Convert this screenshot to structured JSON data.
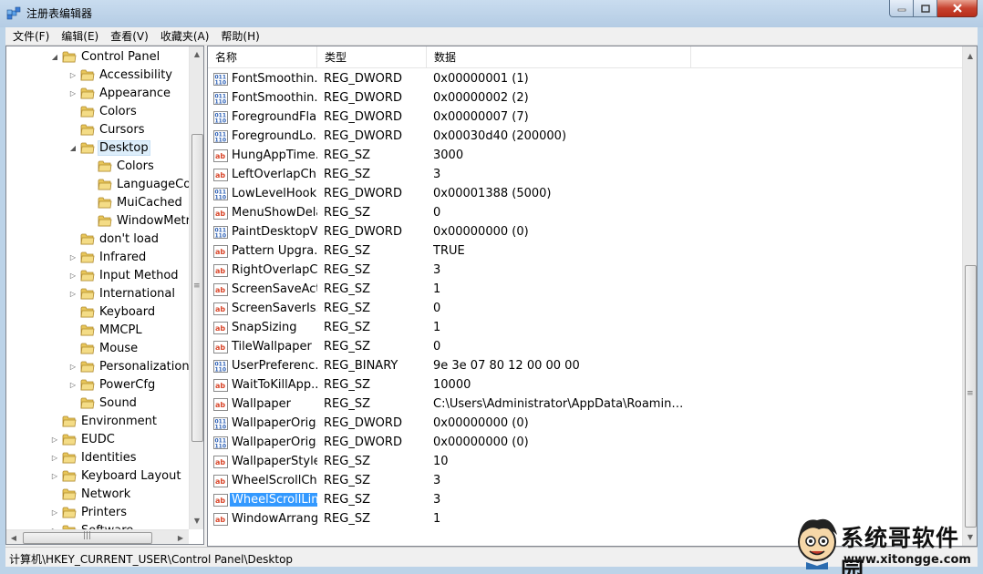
{
  "window": {
    "title": "注册表编辑器"
  },
  "menu": [
    "文件(F)",
    "编辑(E)",
    "查看(V)",
    "收藏夹(A)",
    "帮助(H)"
  ],
  "tree": [
    {
      "label": "Control Panel",
      "depth": 0,
      "expander": "open"
    },
    {
      "label": "Accessibility",
      "depth": 1,
      "expander": "closed"
    },
    {
      "label": "Appearance",
      "depth": 1,
      "expander": "closed"
    },
    {
      "label": "Colors",
      "depth": 1,
      "expander": "none"
    },
    {
      "label": "Cursors",
      "depth": 1,
      "expander": "none"
    },
    {
      "label": "Desktop",
      "depth": 1,
      "expander": "open",
      "selected": true
    },
    {
      "label": "Colors",
      "depth": 2,
      "expander": "none"
    },
    {
      "label": "LanguageConfiguration",
      "depth": 2,
      "expander": "none"
    },
    {
      "label": "MuiCached",
      "depth": 2,
      "expander": "none"
    },
    {
      "label": "WindowMetrics",
      "depth": 2,
      "expander": "none"
    },
    {
      "label": "don't load",
      "depth": 1,
      "expander": "none"
    },
    {
      "label": "Infrared",
      "depth": 1,
      "expander": "closed"
    },
    {
      "label": "Input Method",
      "depth": 1,
      "expander": "closed"
    },
    {
      "label": "International",
      "depth": 1,
      "expander": "closed"
    },
    {
      "label": "Keyboard",
      "depth": 1,
      "expander": "none"
    },
    {
      "label": "MMCPL",
      "depth": 1,
      "expander": "none"
    },
    {
      "label": "Mouse",
      "depth": 1,
      "expander": "none"
    },
    {
      "label": "Personalization",
      "depth": 1,
      "expander": "closed"
    },
    {
      "label": "PowerCfg",
      "depth": 1,
      "expander": "closed"
    },
    {
      "label": "Sound",
      "depth": 1,
      "expander": "none"
    },
    {
      "label": "Environment",
      "depth": 0,
      "expander": "none"
    },
    {
      "label": "EUDC",
      "depth": 0,
      "expander": "closed"
    },
    {
      "label": "Identities",
      "depth": 0,
      "expander": "closed"
    },
    {
      "label": "Keyboard Layout",
      "depth": 0,
      "expander": "closed"
    },
    {
      "label": "Network",
      "depth": 0,
      "expander": "none"
    },
    {
      "label": "Printers",
      "depth": 0,
      "expander": "closed"
    },
    {
      "label": "Software",
      "depth": 0,
      "expander": "closed"
    }
  ],
  "columns": {
    "name": "名称",
    "type": "类型",
    "data": "数据"
  },
  "values": [
    {
      "name": "FontSmoothin...",
      "type": "REG_DWORD",
      "data": "0x00000001 (1)",
      "icon": "binary-value-icon"
    },
    {
      "name": "FontSmoothin...",
      "type": "REG_DWORD",
      "data": "0x00000002 (2)",
      "icon": "binary-value-icon"
    },
    {
      "name": "ForegroundFla...",
      "type": "REG_DWORD",
      "data": "0x00000007 (7)",
      "icon": "binary-value-icon"
    },
    {
      "name": "ForegroundLo...",
      "type": "REG_DWORD",
      "data": "0x00030d40 (200000)",
      "icon": "binary-value-icon"
    },
    {
      "name": "HungAppTime...",
      "type": "REG_SZ",
      "data": "3000",
      "icon": "string-value-icon"
    },
    {
      "name": "LeftOverlapCh...",
      "type": "REG_SZ",
      "data": "3",
      "icon": "string-value-icon"
    },
    {
      "name": "LowLevelHook...",
      "type": "REG_DWORD",
      "data": "0x00001388 (5000)",
      "icon": "binary-value-icon"
    },
    {
      "name": "MenuShowDelay",
      "type": "REG_SZ",
      "data": "0",
      "icon": "string-value-icon"
    },
    {
      "name": "PaintDesktopV...",
      "type": "REG_DWORD",
      "data": "0x00000000 (0)",
      "icon": "binary-value-icon"
    },
    {
      "name": "Pattern Upgra...",
      "type": "REG_SZ",
      "data": "TRUE",
      "icon": "string-value-icon"
    },
    {
      "name": "RightOverlapC...",
      "type": "REG_SZ",
      "data": "3",
      "icon": "string-value-icon"
    },
    {
      "name": "ScreenSaveActi...",
      "type": "REG_SZ",
      "data": "1",
      "icon": "string-value-icon"
    },
    {
      "name": "ScreenSaverIs...",
      "type": "REG_SZ",
      "data": "0",
      "icon": "string-value-icon"
    },
    {
      "name": "SnapSizing",
      "type": "REG_SZ",
      "data": "1",
      "icon": "string-value-icon"
    },
    {
      "name": "TileWallpaper",
      "type": "REG_SZ",
      "data": "0",
      "icon": "string-value-icon"
    },
    {
      "name": "UserPreferenc...",
      "type": "REG_BINARY",
      "data": "9e 3e 07 80 12 00 00 00",
      "icon": "binary-value-icon"
    },
    {
      "name": "WaitToKillApp...",
      "type": "REG_SZ",
      "data": "10000",
      "icon": "string-value-icon"
    },
    {
      "name": "Wallpaper",
      "type": "REG_SZ",
      "data": "C:\\Users\\Administrator\\AppData\\Roaming\\Mi...",
      "icon": "string-value-icon"
    },
    {
      "name": "WallpaperOrig...",
      "type": "REG_DWORD",
      "data": "0x00000000 (0)",
      "icon": "binary-value-icon"
    },
    {
      "name": "WallpaperOrig...",
      "type": "REG_DWORD",
      "data": "0x00000000 (0)",
      "icon": "binary-value-icon"
    },
    {
      "name": "WallpaperStyle",
      "type": "REG_SZ",
      "data": "10",
      "icon": "string-value-icon"
    },
    {
      "name": "WheelScrollCh...",
      "type": "REG_SZ",
      "data": "3",
      "icon": "string-value-icon"
    },
    {
      "name": "WheelScrollLin...",
      "type": "REG_SZ",
      "data": "3",
      "icon": "string-value-icon",
      "selected": true
    },
    {
      "name": "WindowArrang...",
      "type": "REG_SZ",
      "data": "1",
      "icon": "string-value-icon"
    }
  ],
  "status": {
    "path": "计算机\\HKEY_CURRENT_USER\\Control Panel\\Desktop"
  },
  "watermark": {
    "name": "系统哥软件园",
    "url": "www.xitongge.com"
  },
  "colors": {
    "selection": "#3399ff",
    "string_icon": "#d9472b",
    "binary_icon": "#2b5fb5",
    "folder": "#e8c65a"
  }
}
